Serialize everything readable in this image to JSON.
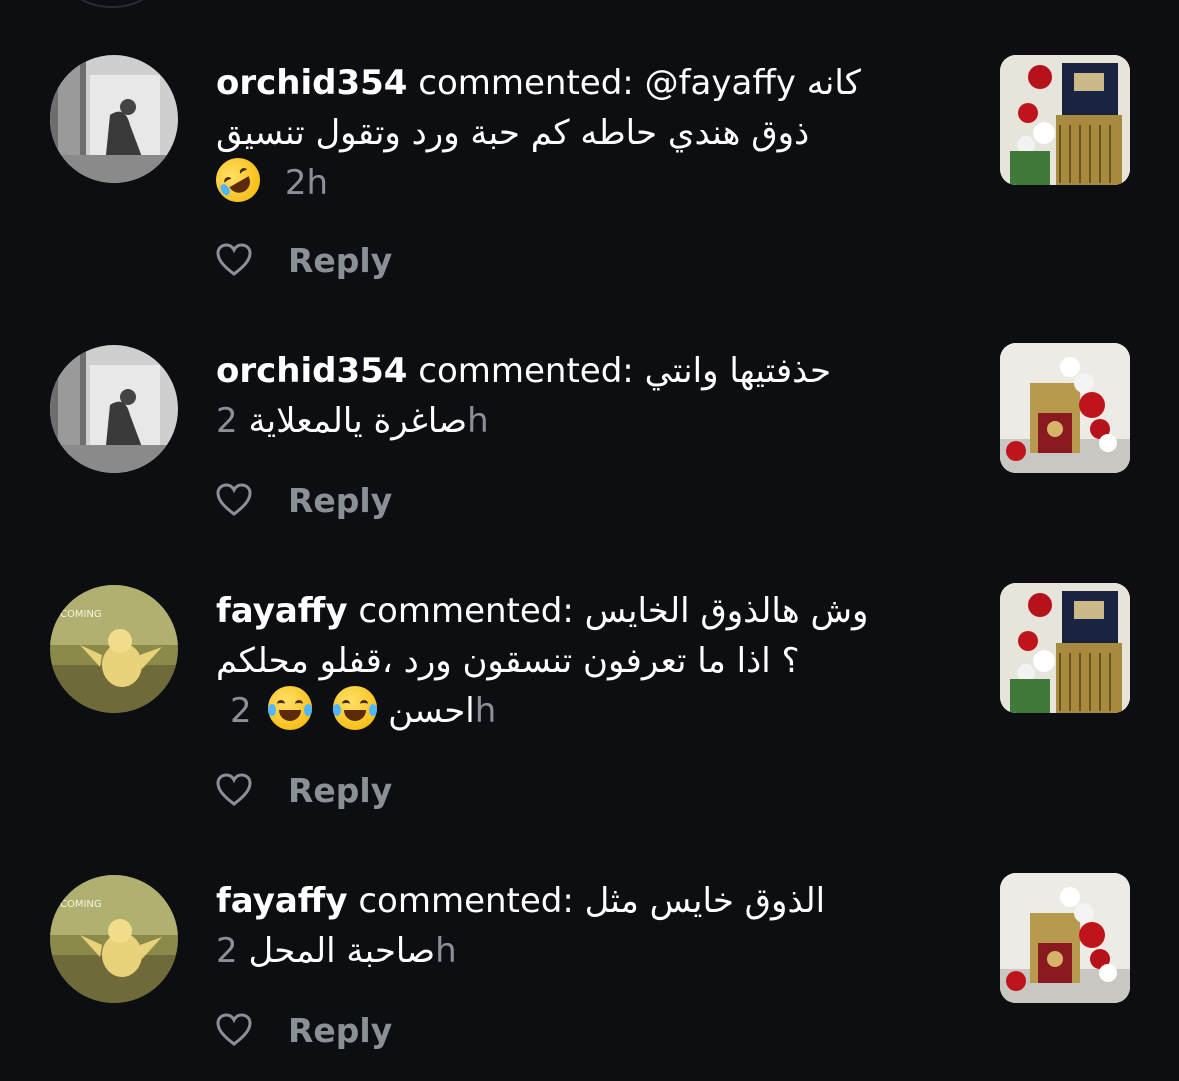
{
  "notifications": [
    {
      "username": "orchid354",
      "verb": "commented:",
      "mention": "@fayaffy",
      "line1_arabic": "كانه",
      "line2": "ذوق هندي حاطه كم حبة ورد وتقول تنسيق",
      "emoji": "rolling-on-floor-laughing",
      "time": "2h",
      "reply": "Reply"
    },
    {
      "username": "orchid354",
      "verb": "commented:",
      "line1_arabic": "حذفتيها وانتي",
      "line2": "صاغرة يالمعلاية",
      "time": "2h",
      "reply": "Reply"
    },
    {
      "username": "fayaffy",
      "verb": "commented:",
      "line1_arabic": "وش هالذوق الخايس",
      "line2": "؟  اذا ما تعرفون تنسقون ورد ،قفلو محلكم",
      "line3": "احسن",
      "emoji": "face-with-tears-of-joy",
      "time": "2h",
      "reply": "Reply"
    },
    {
      "username": "fayaffy",
      "verb": "commented:",
      "line1_arabic": "الذوق خايس مثل",
      "line2": "صاحبة المحل",
      "time": "2h",
      "reply": "Reply"
    }
  ],
  "colors": {
    "background": "#0c0e12",
    "text": "#ffffff",
    "muted": "#8b8f96"
  }
}
